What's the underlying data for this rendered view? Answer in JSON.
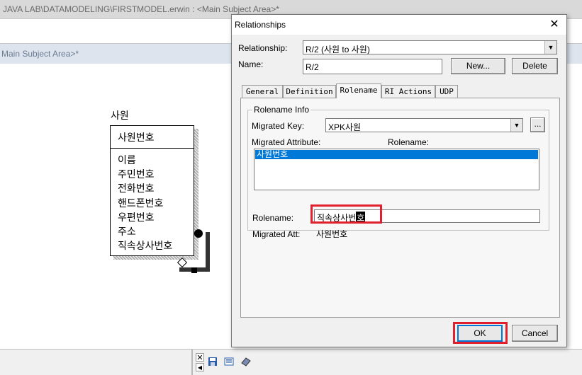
{
  "background_window": {
    "title": "JAVA LAB\\DATAMODELING\\FIRSTMODEL.erwin : <Main Subject Area>*",
    "subject_area_tab": "Main Subject Area>*"
  },
  "entity": {
    "name": "사원",
    "primary_key": "사원번호",
    "attributes": [
      "이름",
      "주민번호",
      "전화번호",
      "핸드폰번호",
      "우편번호",
      "주소",
      "직속상사번호"
    ]
  },
  "bottom_panel": {
    "close_glyph": "✕",
    "arrow_glyph": "◀"
  },
  "dialog": {
    "title": "Relationships",
    "close_glyph": "✕",
    "relationship_label": "Relationship:",
    "relationship_value": "R/2 (사원 to 사원)",
    "name_label": "Name:",
    "name_value": "R/2",
    "new_button": "New...",
    "delete_button": "Delete",
    "tabs": [
      "General",
      "Definition",
      "Rolename",
      "RI Actions",
      "UDP"
    ],
    "active_tab": "Rolename",
    "rolename_info": {
      "group_title": "Rolename Info",
      "migrated_key_label": "Migrated Key:",
      "migrated_key_value": "XPK사원",
      "browse_button": "...",
      "migrated_attribute_label": "Migrated Attribute:",
      "rolename_column_label": "Rolename:",
      "attributes": [
        "사원번호"
      ]
    },
    "rolename_label": "Rolename:",
    "rolename_value": "직속상사번",
    "rolename_composing": "호",
    "migrated_att_label": "Migrated Att:",
    "migrated_att_value": "사원번호",
    "ok_button": "OK",
    "cancel_button": "Cancel",
    "highlight_color": "#e0202e",
    "selection_color": "#0078d7"
  }
}
